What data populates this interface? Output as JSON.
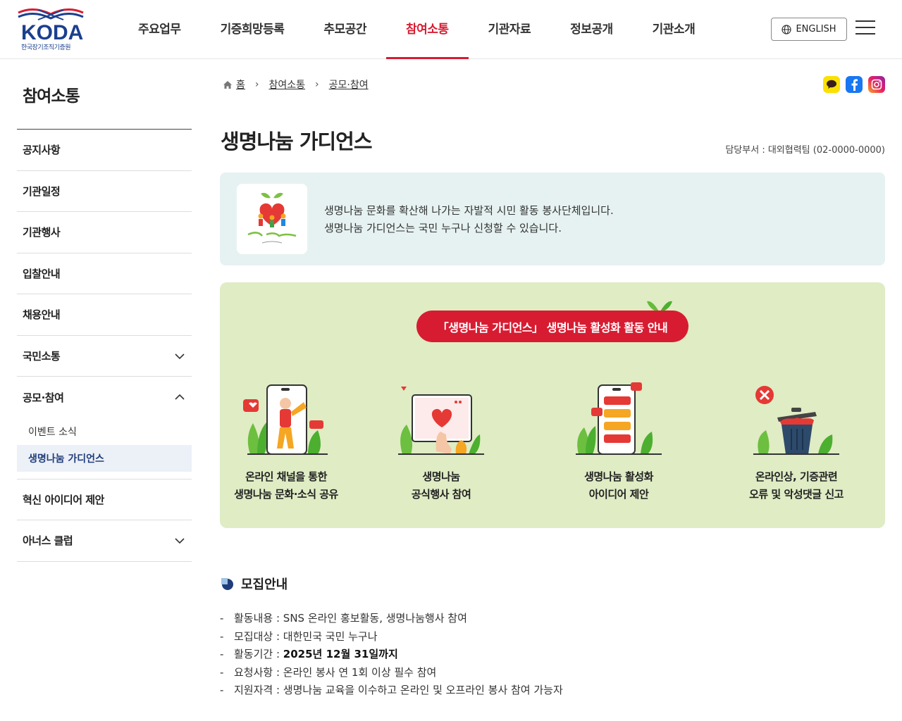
{
  "header": {
    "logo_text": "KODA",
    "logo_sub": "한국장기조직기증원",
    "nav": [
      "주요업무",
      "기증희망등록",
      "추모공간",
      "참여소통",
      "기관자료",
      "정보공개",
      "기관소개"
    ],
    "active_nav": "참여소통",
    "english_label": "ENGLISH",
    "accent_color": "#d71c32",
    "brand_color": "#1b3f8f"
  },
  "sidebar": {
    "title": "참여소통",
    "items": [
      "공지사항",
      "기관일정",
      "기관행사",
      "입찰안내",
      "채용안내",
      "국민소통",
      "공모·참여",
      "혁신 아이디어 제안",
      "아너스 클럽"
    ],
    "sub_items": [
      "이벤트 소식",
      "생명나눔 가디언스"
    ],
    "active_sub": "생명나눔 가디언스"
  },
  "breadcrumb": {
    "home": "홈",
    "level1": "참여소통",
    "level2": "공모·참여"
  },
  "page": {
    "title": "생명나눔 가디언스",
    "dept": "담당부서 : 대외협력팀 (02-0000-0000)"
  },
  "intro": {
    "line1": "생명나눔 문화를 확산해 나가는 자발적 시민 활동 봉사단체입니다.",
    "line2": "생명나눔 가디언스는 국민 누구나 신청할 수 있습니다."
  },
  "activity": {
    "badge": "「생명나눔 가디언스」 생명나눔 활성화 활동 안내",
    "items": [
      {
        "line1": "온라인 채널을 통한",
        "line2": "생명나눔 문화·소식 공유"
      },
      {
        "line1": "생명나눔",
        "line2": "공식행사 참여"
      },
      {
        "line1": "생명나눔 활성화",
        "line2": "아이디어 제안"
      },
      {
        "line1": "온라인상, 기증관련",
        "line2": "오류 및 악성댓글 신고"
      }
    ]
  },
  "recruit": {
    "title": "모집안내",
    "items": [
      {
        "label": "활동내용 : ",
        "value": "SNS 온라인 홍보활동, 생명나눔행사 참여",
        "bold": false
      },
      {
        "label": "모집대상 : ",
        "value": "대한민국 국민 누구나",
        "bold": false
      },
      {
        "label": "활동기간 : ",
        "value": "2025년 12월 31일까지",
        "bold": true
      },
      {
        "label": "요청사항 : ",
        "value": "온라인 봉사 연 1회 이상 필수 참여",
        "bold": false
      },
      {
        "label": "지원자격 : ",
        "value": "생명나눔 교육을 이수하고 온라인 및 오프라인 봉사 참여 가능자",
        "bold": false
      }
    ]
  },
  "icons": [
    "globe-icon",
    "menu-icon",
    "home-icon",
    "kakao-icon",
    "facebook-icon",
    "instagram-icon"
  ]
}
